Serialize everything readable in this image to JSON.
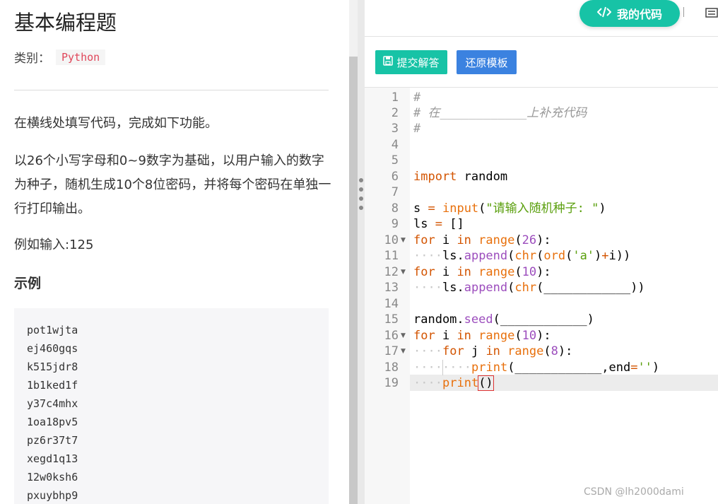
{
  "problem": {
    "title": "基本编程题",
    "category_label": "类别：",
    "category_value": "Python",
    "para1": "在横线处填写代码，完成如下功能。",
    "para2": "以26个小写字母和0~9数字为基础，以用户输入的数字为种子，随机生成10个8位密码，并将每个密码在单独一行打印输出。",
    "para3": "例如输入:125",
    "example_title": "示例",
    "example_lines": [
      "pot1wjta",
      "ej460gqs",
      "k515jdr8",
      "1b1ked1f",
      "y37c4mhx",
      "1oa18pv5",
      "pz6r37t7",
      "xegd1q13",
      "12w0ksh6",
      "pxuybhp9"
    ]
  },
  "header": {
    "my_code_label": "我的代码",
    "code_icon": "code-icon",
    "list_icon": "list-icon"
  },
  "toolbar": {
    "submit_label": "提交解答",
    "submit_icon": "save-icon",
    "reset_label": "还原模板"
  },
  "editor": {
    "line_numbers": [
      "1",
      "2",
      "3",
      "4",
      "5",
      "6",
      "7",
      "8",
      "9",
      "10",
      "11",
      "12",
      "13",
      "14",
      "15",
      "16",
      "17",
      "18",
      "19"
    ],
    "lines": [
      "#",
      "# 在____________上补充代码",
      "#",
      "",
      "",
      "import random",
      "",
      "s = input(\"请输入随机种子: \")",
      "ls = []",
      "for i in range(26):",
      "    ls.append(chr(ord('a')+i))",
      "for i in range(10):",
      "    ls.append(chr(____________))",
      "",
      "random.seed(____________)",
      "for i in range(10):",
      "    for j in range(8):",
      "        print(____________,end='')",
      "    print()"
    ]
  },
  "colors": {
    "accent_teal": "#17c3a6",
    "accent_blue": "#3b82e0",
    "category_red": "#e0465a"
  },
  "watermark": "CSDN @lh2000dami"
}
